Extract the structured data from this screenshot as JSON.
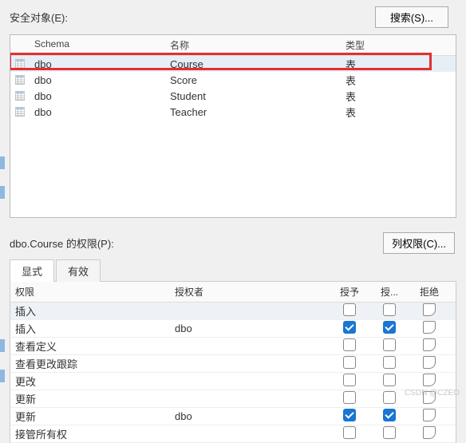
{
  "top": {
    "label": "安全对象(E):",
    "search_button": "搜索(S)..."
  },
  "columns": {
    "schema": "Schema",
    "name": "名称",
    "type": "类型"
  },
  "rows": [
    {
      "schema": "dbo",
      "name": "Course",
      "type": "表",
      "selected": true
    },
    {
      "schema": "dbo",
      "name": "Score",
      "type": "表",
      "selected": false
    },
    {
      "schema": "dbo",
      "name": "Student",
      "type": "表",
      "selected": false
    },
    {
      "schema": "dbo",
      "name": "Teacher",
      "type": "表",
      "selected": false
    }
  ],
  "perm_section": {
    "label": "dbo.Course 的权限(P):",
    "column_perm_button": "列权限(C)..."
  },
  "tabs": {
    "explicit": "显式",
    "effective": "有效"
  },
  "perm_columns": {
    "permission": "权限",
    "grantor": "授权者",
    "grant": "授予",
    "with": "授...",
    "deny": "拒绝"
  },
  "perm_rows": [
    {
      "name": "插入",
      "grantor": "",
      "grant": false,
      "with": false,
      "deny": false,
      "hl": true
    },
    {
      "name": "插入",
      "grantor": "dbo",
      "grant": true,
      "with": true,
      "deny": false,
      "hl": false
    },
    {
      "name": "查看定义",
      "grantor": "",
      "grant": false,
      "with": false,
      "deny": false,
      "hl": false
    },
    {
      "name": "查看更改跟踪",
      "grantor": "",
      "grant": false,
      "with": false,
      "deny": false,
      "hl": false
    },
    {
      "name": "更改",
      "grantor": "",
      "grant": false,
      "with": false,
      "deny": false,
      "hl": false
    },
    {
      "name": "更新",
      "grantor": "",
      "grant": false,
      "with": false,
      "deny": false,
      "hl": false
    },
    {
      "name": "更新",
      "grantor": "dbo",
      "grant": true,
      "with": true,
      "deny": false,
      "hl": false
    },
    {
      "name": "接管所有权",
      "grantor": "",
      "grant": false,
      "with": false,
      "deny": false,
      "hl": false
    }
  ],
  "watermark": "CSDN @CZEO"
}
